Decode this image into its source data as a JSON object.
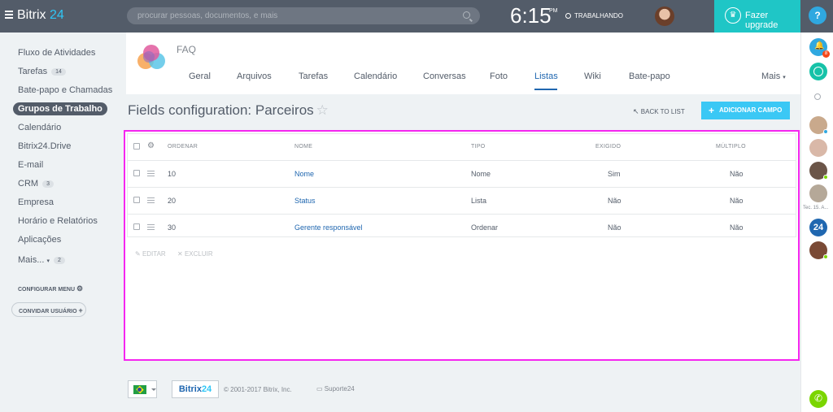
{
  "topbar": {
    "logo_name": "Bitrix",
    "logo_num": "24",
    "search_placeholder": "procurar pessoas, documentos, e mais",
    "clock": "6:15",
    "ampm": "PM",
    "work_status": "TRABALHANDO",
    "upgrade_label": "Fazer upgrade",
    "help_label": "?"
  },
  "nav": {
    "items": [
      {
        "label": "Fluxo de Atividades",
        "count": null
      },
      {
        "label": "Tarefas",
        "count": "14"
      },
      {
        "label": "Bate-papo e Chamadas",
        "count": null
      },
      {
        "label": "Grupos de Trabalho",
        "count": null
      },
      {
        "label": "Calendário",
        "count": null
      },
      {
        "label": "Bitrix24.Drive",
        "count": null
      },
      {
        "label": "E-mail",
        "count": null
      },
      {
        "label": "CRM",
        "count": "3"
      },
      {
        "label": "Empresa",
        "count": null
      },
      {
        "label": "Horário e Relatórios",
        "count": null
      },
      {
        "label": "Aplicações",
        "count": null
      },
      {
        "label": "Mais...",
        "count": "2"
      }
    ],
    "configure_menu": "CONFIGURAR MENU",
    "invite_users": "CONVIDAR USUÁRIO"
  },
  "group": {
    "name": "FAQ",
    "tabs": [
      "Geral",
      "Arquivos",
      "Tarefas",
      "Calendário",
      "Conversas",
      "Foto",
      "Listas",
      "Wiki",
      "Bate-papo"
    ],
    "active_tab": "Listas",
    "more_label": "Mais"
  },
  "page": {
    "title": "Fields configuration: Parceiros",
    "back_label": "BACK TO LIST",
    "add_label": "ADICIONAR CAMPO"
  },
  "grid": {
    "columns": [
      "ORDENAR",
      "NOME",
      "TIPO",
      "EXIGIDO",
      "MÚLTIPLO"
    ],
    "rows": [
      {
        "order": "10",
        "name": "Nome",
        "type": "Nome",
        "required": "Sim",
        "multiple": "Não"
      },
      {
        "order": "20",
        "name": "Status",
        "type": "Lista",
        "required": "Não",
        "multiple": "Não"
      },
      {
        "order": "30",
        "name": "Gerente responsável",
        "type": "Ordenar",
        "required": "Não",
        "multiple": "Não"
      }
    ],
    "edit_label": "EDITAR",
    "delete_label": "EXCLUIR"
  },
  "footer": {
    "logo_name": "Bitrix",
    "logo_num": "24",
    "copyright": "© 2001-2017 Bitrix, Inc.",
    "support": "Suporte24"
  },
  "rightbar": {
    "notifications_count": "8",
    "contact_label": "Tec. 15. A..."
  },
  "colors": {
    "topbar": "#535c69",
    "accent": "#2fc6f6",
    "upgrade": "#1fc6c6",
    "link": "#2067b0",
    "highlight": "#f526f0"
  }
}
